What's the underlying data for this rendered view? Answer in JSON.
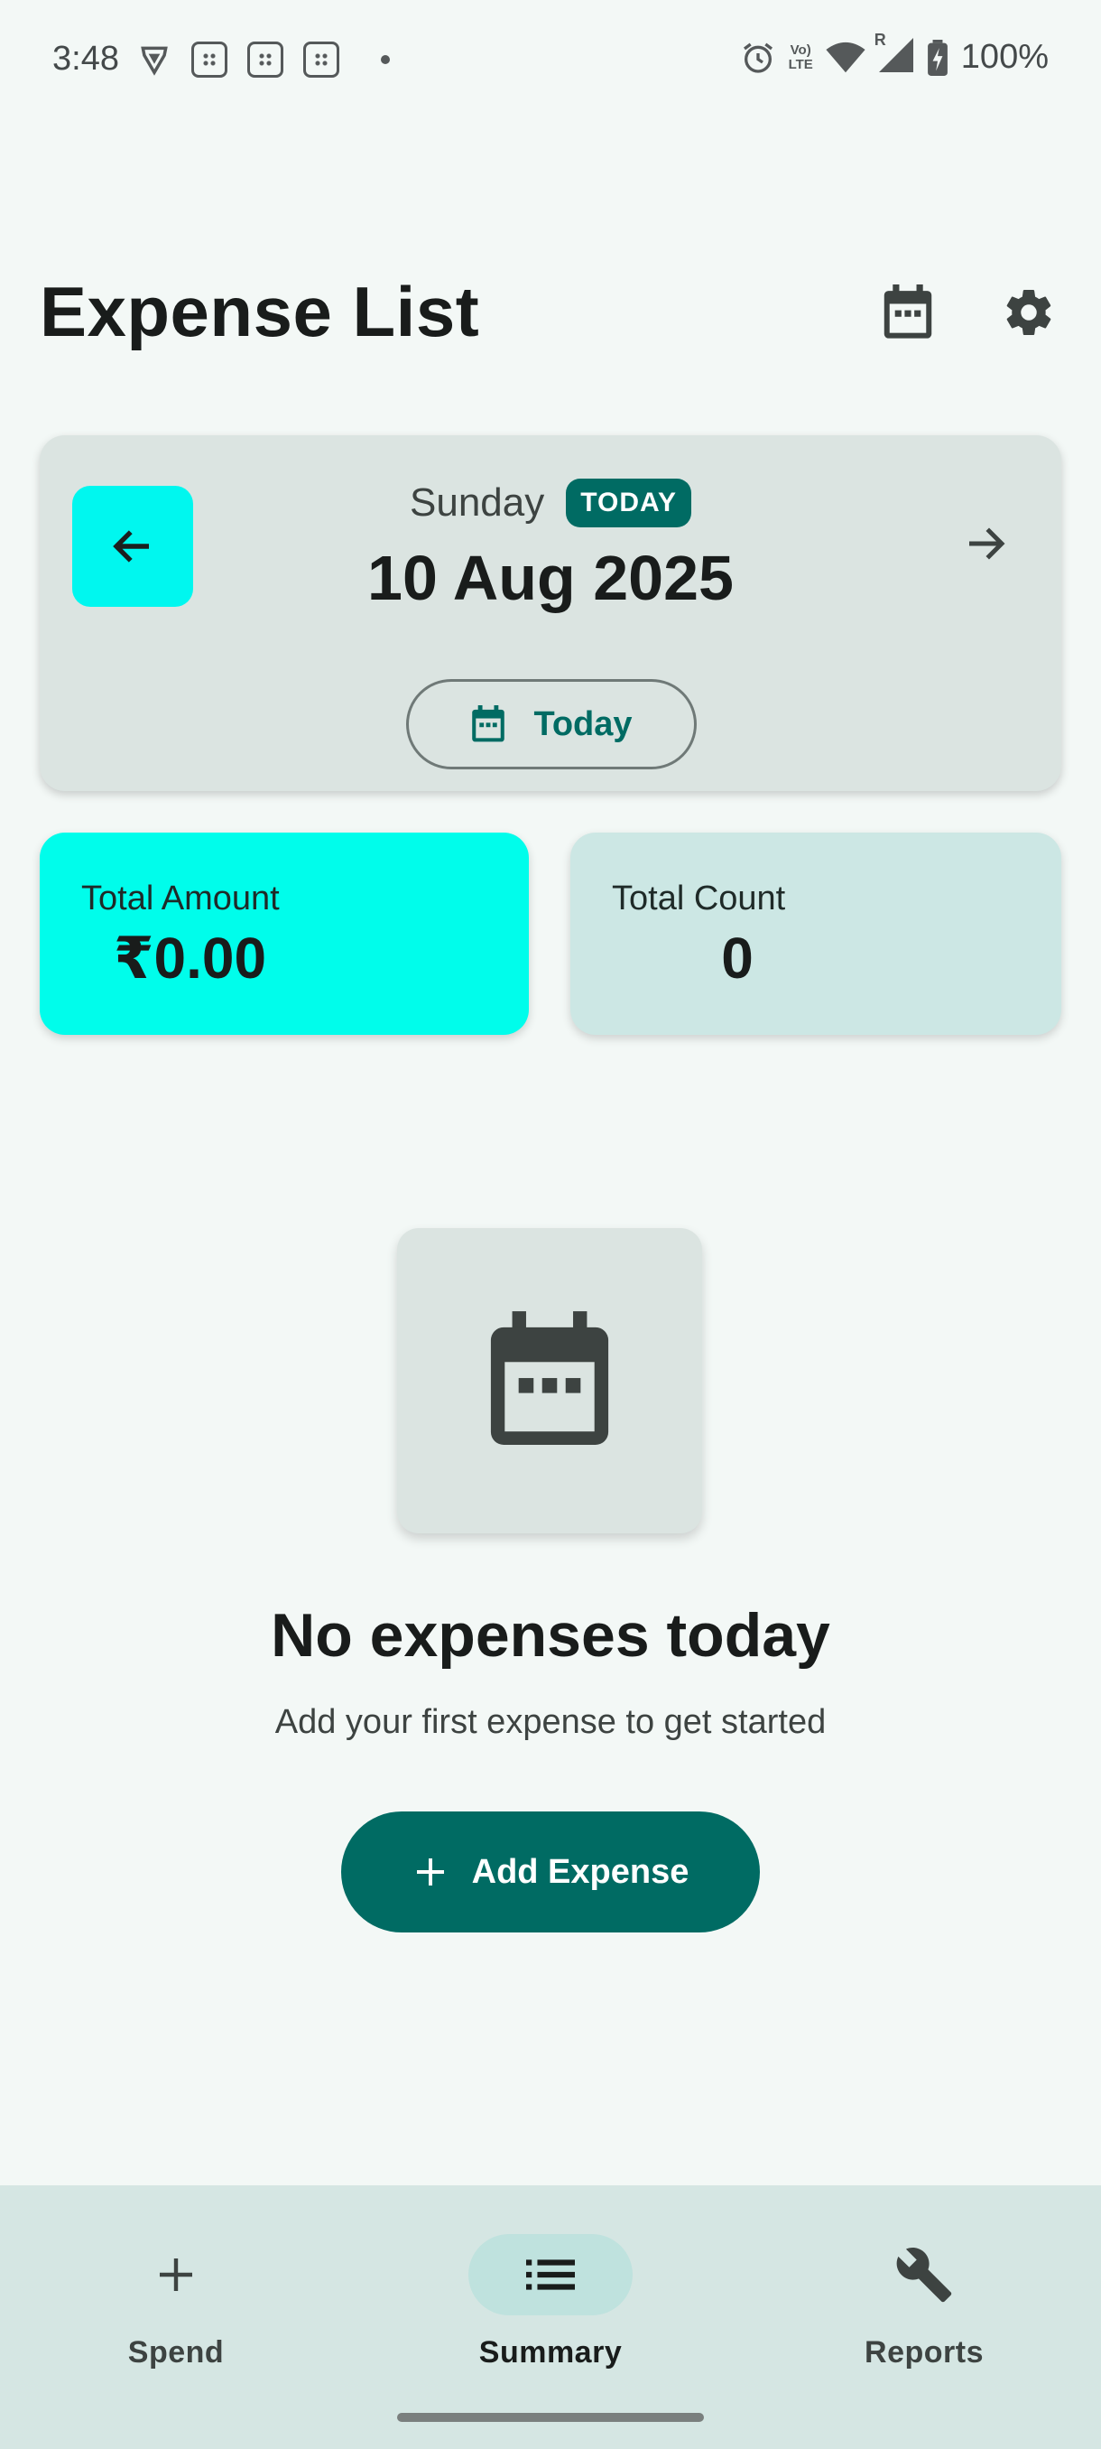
{
  "status_bar": {
    "time": "3:48",
    "battery": "100%",
    "network_label_top": "Vo)",
    "network_label_bottom": "LTE",
    "roaming_label": "R"
  },
  "header": {
    "title": "Expense List",
    "calendar_icon": "calendar-icon",
    "settings_icon": "gear-icon"
  },
  "date_card": {
    "day_name": "Sunday",
    "badge": "TODAY",
    "date": "10 Aug 2025",
    "today_button": "Today"
  },
  "stats": {
    "amount_label": "Total Amount",
    "amount_value": "₹0.00",
    "count_label": "Total Count",
    "count_value": "0"
  },
  "empty_state": {
    "title": "No expenses today",
    "subtitle": "Add your first expense to get started",
    "button": "Add Expense"
  },
  "bottom_nav": {
    "items": [
      {
        "label": "Spend",
        "icon": "plus-icon"
      },
      {
        "label": "Summary",
        "icon": "list-icon",
        "selected": true
      },
      {
        "label": "Reports",
        "icon": "wrench-icon"
      }
    ]
  },
  "colors": {
    "accent": "#006b63",
    "cyan": "#00fdeb",
    "background": "#f3f8f6"
  }
}
